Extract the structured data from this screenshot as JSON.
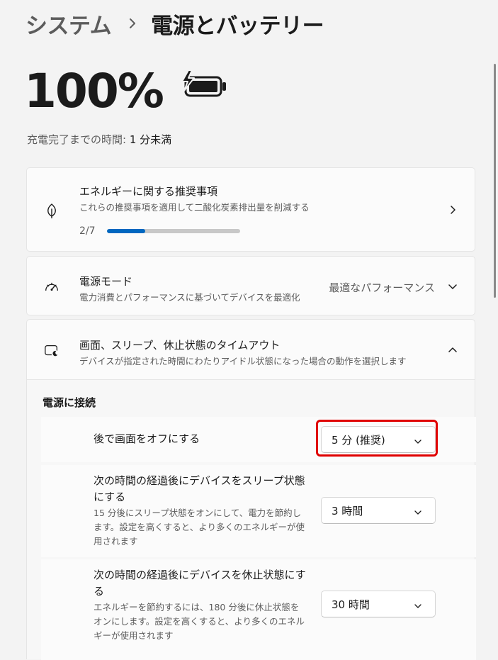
{
  "breadcrumb": {
    "parent": "システム",
    "current": "電源とバッテリー"
  },
  "battery": {
    "percent": "100%",
    "charge_label": "充電完了までの時間:",
    "charge_value": "1 分未満"
  },
  "energy_card": {
    "title": "エネルギーに関する推奨事項",
    "subtitle": "これらの推奨事項を適用して二酸化炭素排出量を削減する",
    "progress_label": "2/7",
    "progress_fraction": 0.2857
  },
  "power_mode": {
    "title": "電源モード",
    "subtitle": "電力消費とパフォーマンスに基づいてデバイスを最適化",
    "value": "最適なパフォーマンス"
  },
  "timeout": {
    "title": "画面、スリープ、休止状態のタイムアウト",
    "subtitle": "デバイスが指定された時間にわたりアイドル状態になった場合の動作を選択します",
    "section_label": "電源に接続",
    "rows": [
      {
        "title": "後で画面をオフにする",
        "value": "5 分 (推奨)"
      },
      {
        "title": "次の時間の経過後にデバイスをスリープ状態にする",
        "description": "15 分後にスリープ状態をオンにして、電力を節約します。設定を高くすると、より多くのエネルギーが使用されます",
        "value": "3 時間"
      },
      {
        "title": "次の時間の経過後にデバイスを休止状態にする",
        "description": "エネルギーを節約するには、180 分後に休止状態をオンにします。設定を高くすると、より多くのエネルギーが使用されます",
        "value": "30 時間"
      }
    ]
  },
  "colors": {
    "accent": "#0067c0",
    "highlight": "#e00000",
    "background": "#f3f3f3"
  },
  "icons": {
    "energy": "leaf-icon",
    "power_mode": "gauge-icon",
    "timeout": "screen-sleep-icon",
    "battery": "battery-charging-icon"
  }
}
